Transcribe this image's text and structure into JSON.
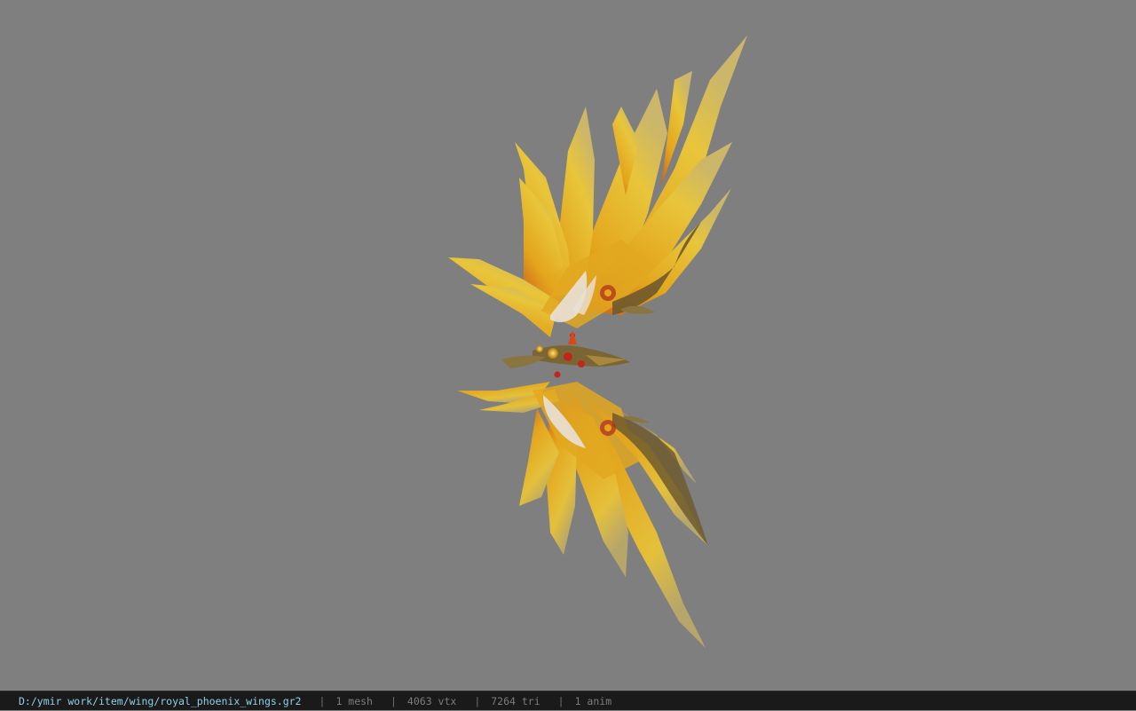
{
  "viewer": {
    "background_color": "#7f7f7f",
    "model": {
      "icon": "phoenix-wings-model",
      "colors": {
        "feather_gold": "#e3b61e",
        "feather_orange": "#d9851b",
        "feather_tip": "#c7b15a",
        "bronze": "#7a6535",
        "ruby": "#c2261b"
      }
    }
  },
  "status_bar": {
    "file_path": "D:/ymir work/item/wing/royal_phoenix_wings.gr2",
    "separator": "|",
    "mesh_count": "1 mesh",
    "vertex_count": "4063 vtx",
    "triangle_count": "7264 tri",
    "anim_count": "1 anim",
    "colors": {
      "background": "#1a1a1a",
      "path_text": "#8fd0e6",
      "stat_text": "#7c7c7c"
    }
  }
}
